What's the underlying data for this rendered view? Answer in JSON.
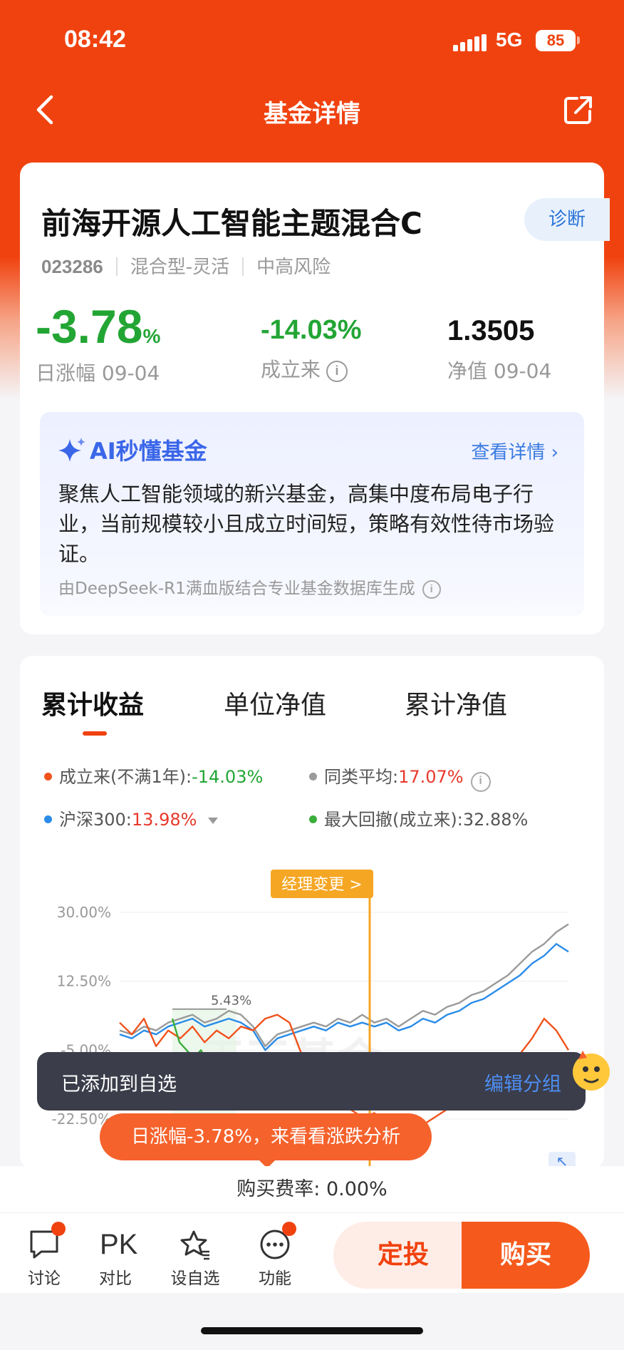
{
  "status_bar": {
    "time": "08:42",
    "network": "5G",
    "battery": "85"
  },
  "nav": {
    "title": "基金详情"
  },
  "fund": {
    "name": "前海开源人工智能主题混合C",
    "diagnose_label": "诊断",
    "code": "023286",
    "type": "混合型-灵活",
    "risk": "中高风险",
    "daily_change_value": "-3.78",
    "daily_change_unit": "%",
    "daily_change_label": "日涨幅 09-04",
    "since_inception_value": "-14.03%",
    "since_inception_label": "成立来",
    "nav_value": "1.3505",
    "nav_label": "净值 09-04"
  },
  "ai": {
    "title": "AI秒懂基金",
    "more_label": "查看详情 ›",
    "text": "聚焦人工智能领域的新兴基金，高集中度布局电子行业，当前规模较小且成立时间短，策略有效性待市场验证。",
    "source": "由DeepSeek-R1满血版结合专业基金数据库生成"
  },
  "tabs": [
    "累计收益",
    "单位净值",
    "累计净值"
  ],
  "legend": {
    "fund_label": "成立来(不满1年):",
    "fund_value": "-14.03%",
    "peer_label": "同类平均:",
    "peer_value": "17.07%",
    "index_label": "沪深300:",
    "index_value": "13.98%",
    "drawdown_label": "最大回撤(成立来):",
    "drawdown_value": "32.88%"
  },
  "chart_data": {
    "type": "line",
    "ytick_labels": [
      "30.00%",
      "12.50%",
      "-5.00%",
      "-22.50%"
    ],
    "ylim": [
      -22.5,
      30
    ],
    "annotation_manager": "经理变更 >",
    "annotation_peak": "5.43%",
    "watermark": "天天基金",
    "series": [
      {
        "name": "成立来",
        "color": "#f0521c",
        "values": [
          2,
          -1,
          3,
          -4,
          0,
          -2,
          1,
          -3,
          0,
          -2,
          1,
          0,
          3,
          4,
          2,
          -6,
          -10,
          -14,
          -18,
          -20,
          -22,
          -21,
          -23,
          -24,
          -25,
          -24,
          -22,
          -20,
          -18,
          -16,
          -14,
          -12,
          -10,
          -6,
          -2,
          3,
          0,
          -5
        ]
      },
      {
        "name": "同类平均",
        "color": "#9a9a9a",
        "values": [
          0,
          -1,
          1,
          0,
          2,
          3,
          4,
          2,
          3,
          5,
          4,
          1,
          -4,
          -1,
          0,
          1,
          2,
          1,
          3,
          2,
          4,
          2,
          3,
          1,
          3,
          5,
          4,
          6,
          7,
          9,
          10,
          12,
          14,
          17,
          20,
          22,
          25,
          27
        ]
      },
      {
        "name": "沪深300",
        "color": "#2a8ce8",
        "values": [
          -1,
          -2,
          0,
          -1,
          1,
          2,
          3,
          1,
          2,
          3,
          2,
          0,
          -5,
          -2,
          -1,
          0,
          1,
          0,
          2,
          1,
          2,
          1,
          2,
          0,
          1,
          3,
          2,
          4,
          5,
          7,
          8,
          10,
          12,
          14,
          17,
          19,
          22,
          20
        ]
      },
      {
        "name": "最大回撤",
        "color": "#3aae3a",
        "values": [
          3,
          -3,
          -5,
          -7,
          -5,
          -8,
          -10,
          -14,
          -16,
          -18
        ]
      }
    ]
  },
  "toast": {
    "message": "已添加到自选",
    "action": "编辑分组"
  },
  "bubble": {
    "text": "日涨幅-3.78%，来看看涨跌分析"
  },
  "fee": {
    "text": "购买费率: 0.00%"
  },
  "bottom": {
    "discuss": "讨论",
    "pk_icon": "PK",
    "compare": "对比",
    "watchlist": "设自选",
    "functions": "功能",
    "auto_invest": "定投",
    "buy": "购买"
  }
}
